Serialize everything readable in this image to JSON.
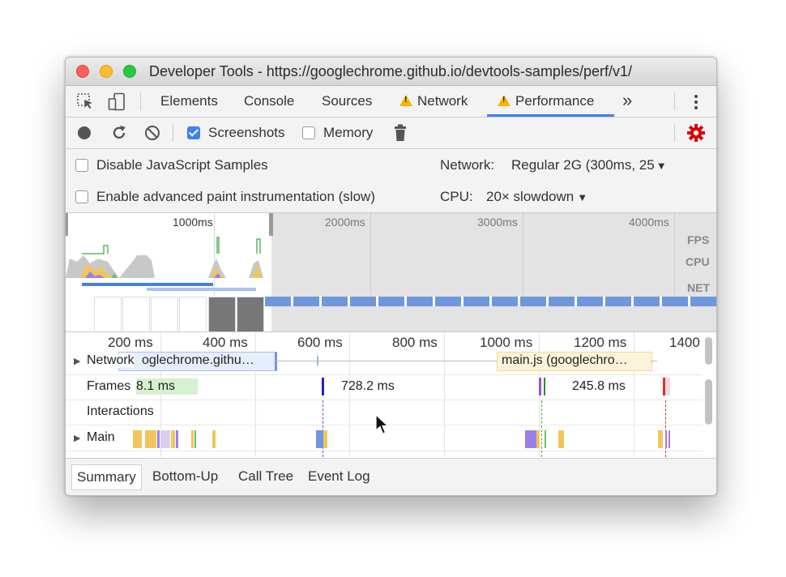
{
  "window": {
    "title": "Developer Tools - https://googlechrome.github.io/devtools-samples/perf/v1/"
  },
  "tabs": [
    {
      "label": "Elements"
    },
    {
      "label": "Console"
    },
    {
      "label": "Sources"
    },
    {
      "label": "Network",
      "warning": true
    },
    {
      "label": "Performance",
      "warning": true,
      "active": true
    }
  ],
  "more_tabs_label": "»",
  "toolbar": {
    "screenshots_label": "Screenshots",
    "screenshots_checked": true,
    "memory_label": "Memory",
    "memory_checked": false
  },
  "settings": {
    "disable_js_label": "Disable JavaScript Samples",
    "paint_label": "Enable advanced paint instrumentation (slow)",
    "network_label": "Network:",
    "network_value": "Regular 2G (300ms, 25",
    "cpu_label": "CPU:",
    "cpu_value": "20× slowdown"
  },
  "overview": {
    "ticks": [
      "1000ms",
      "2000ms",
      "3000ms",
      "4000ms"
    ],
    "lanes": {
      "fps": "FPS",
      "cpu": "CPU",
      "net": "NET"
    }
  },
  "timeline": {
    "ruler": [
      "200 ms",
      "400 ms",
      "600 ms",
      "800 ms",
      "1000 ms",
      "1200 ms",
      "1400"
    ],
    "tracks": {
      "network": "Network",
      "frames": "Frames",
      "interactions": "Interactions",
      "main": "Main"
    },
    "network_bar_1": "oglechrome.githu…",
    "network_bar_2": "main.js (googlechro…",
    "frame_1": "8.1 ms",
    "frame_2": "728.2 ms",
    "frame_3": "245.8 ms"
  },
  "bottom_tabs": [
    {
      "label": "Summary",
      "selected": true
    },
    {
      "label": "Bottom-Up"
    },
    {
      "label": "Call Tree"
    },
    {
      "label": "Event Log"
    }
  ],
  "colors": {
    "accent": "#3b82f6",
    "scripting": "#f2c55c",
    "rendering": "#9b7fe6",
    "painting": "#6ac06a",
    "warning": "#f4b400",
    "settings_gear": "#d60000"
  }
}
